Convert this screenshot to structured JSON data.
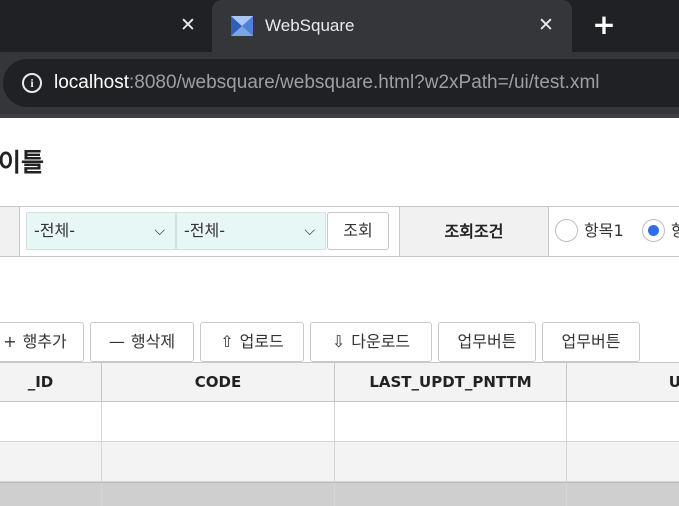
{
  "browser": {
    "active_tab_title": "WebSquare",
    "url_host": "localhost",
    "url_rest": ":8080/websquare/websquare.html?w2xPath=/ui/test.xml",
    "close_glyph": "✕",
    "new_tab_glyph": "+",
    "info_glyph": "i"
  },
  "page": {
    "title": "이틀"
  },
  "search": {
    "select1_value": "-전체-",
    "select2_value": "-전체-",
    "search_button": "조회",
    "condition_label": "조회조건",
    "radio1_label": "항목1",
    "radio2_label": "항",
    "radio2_checked": true
  },
  "grid_buttons": [
    {
      "icon": "+",
      "label": "행추가"
    },
    {
      "icon": "—",
      "label": "행삭제"
    },
    {
      "icon": "⇧",
      "label": "업로드"
    },
    {
      "icon": "⇩",
      "label": "다운로드"
    },
    {
      "icon": "",
      "label": "업무버튼"
    },
    {
      "icon": "",
      "label": "업무버튼"
    }
  ],
  "grid": {
    "columns": [
      "_ID",
      "CODE",
      "LAST_UPDT_PNTTM",
      "USI"
    ],
    "rows": [
      [
        "",
        "",
        "",
        ""
      ],
      [
        "",
        "",
        "",
        ""
      ],
      [
        "",
        "",
        "",
        ""
      ]
    ]
  },
  "colors": {
    "select_bg": "#e6f7f6",
    "radio_accent": "#2f6fe4",
    "chrome_dark": "#202124"
  }
}
